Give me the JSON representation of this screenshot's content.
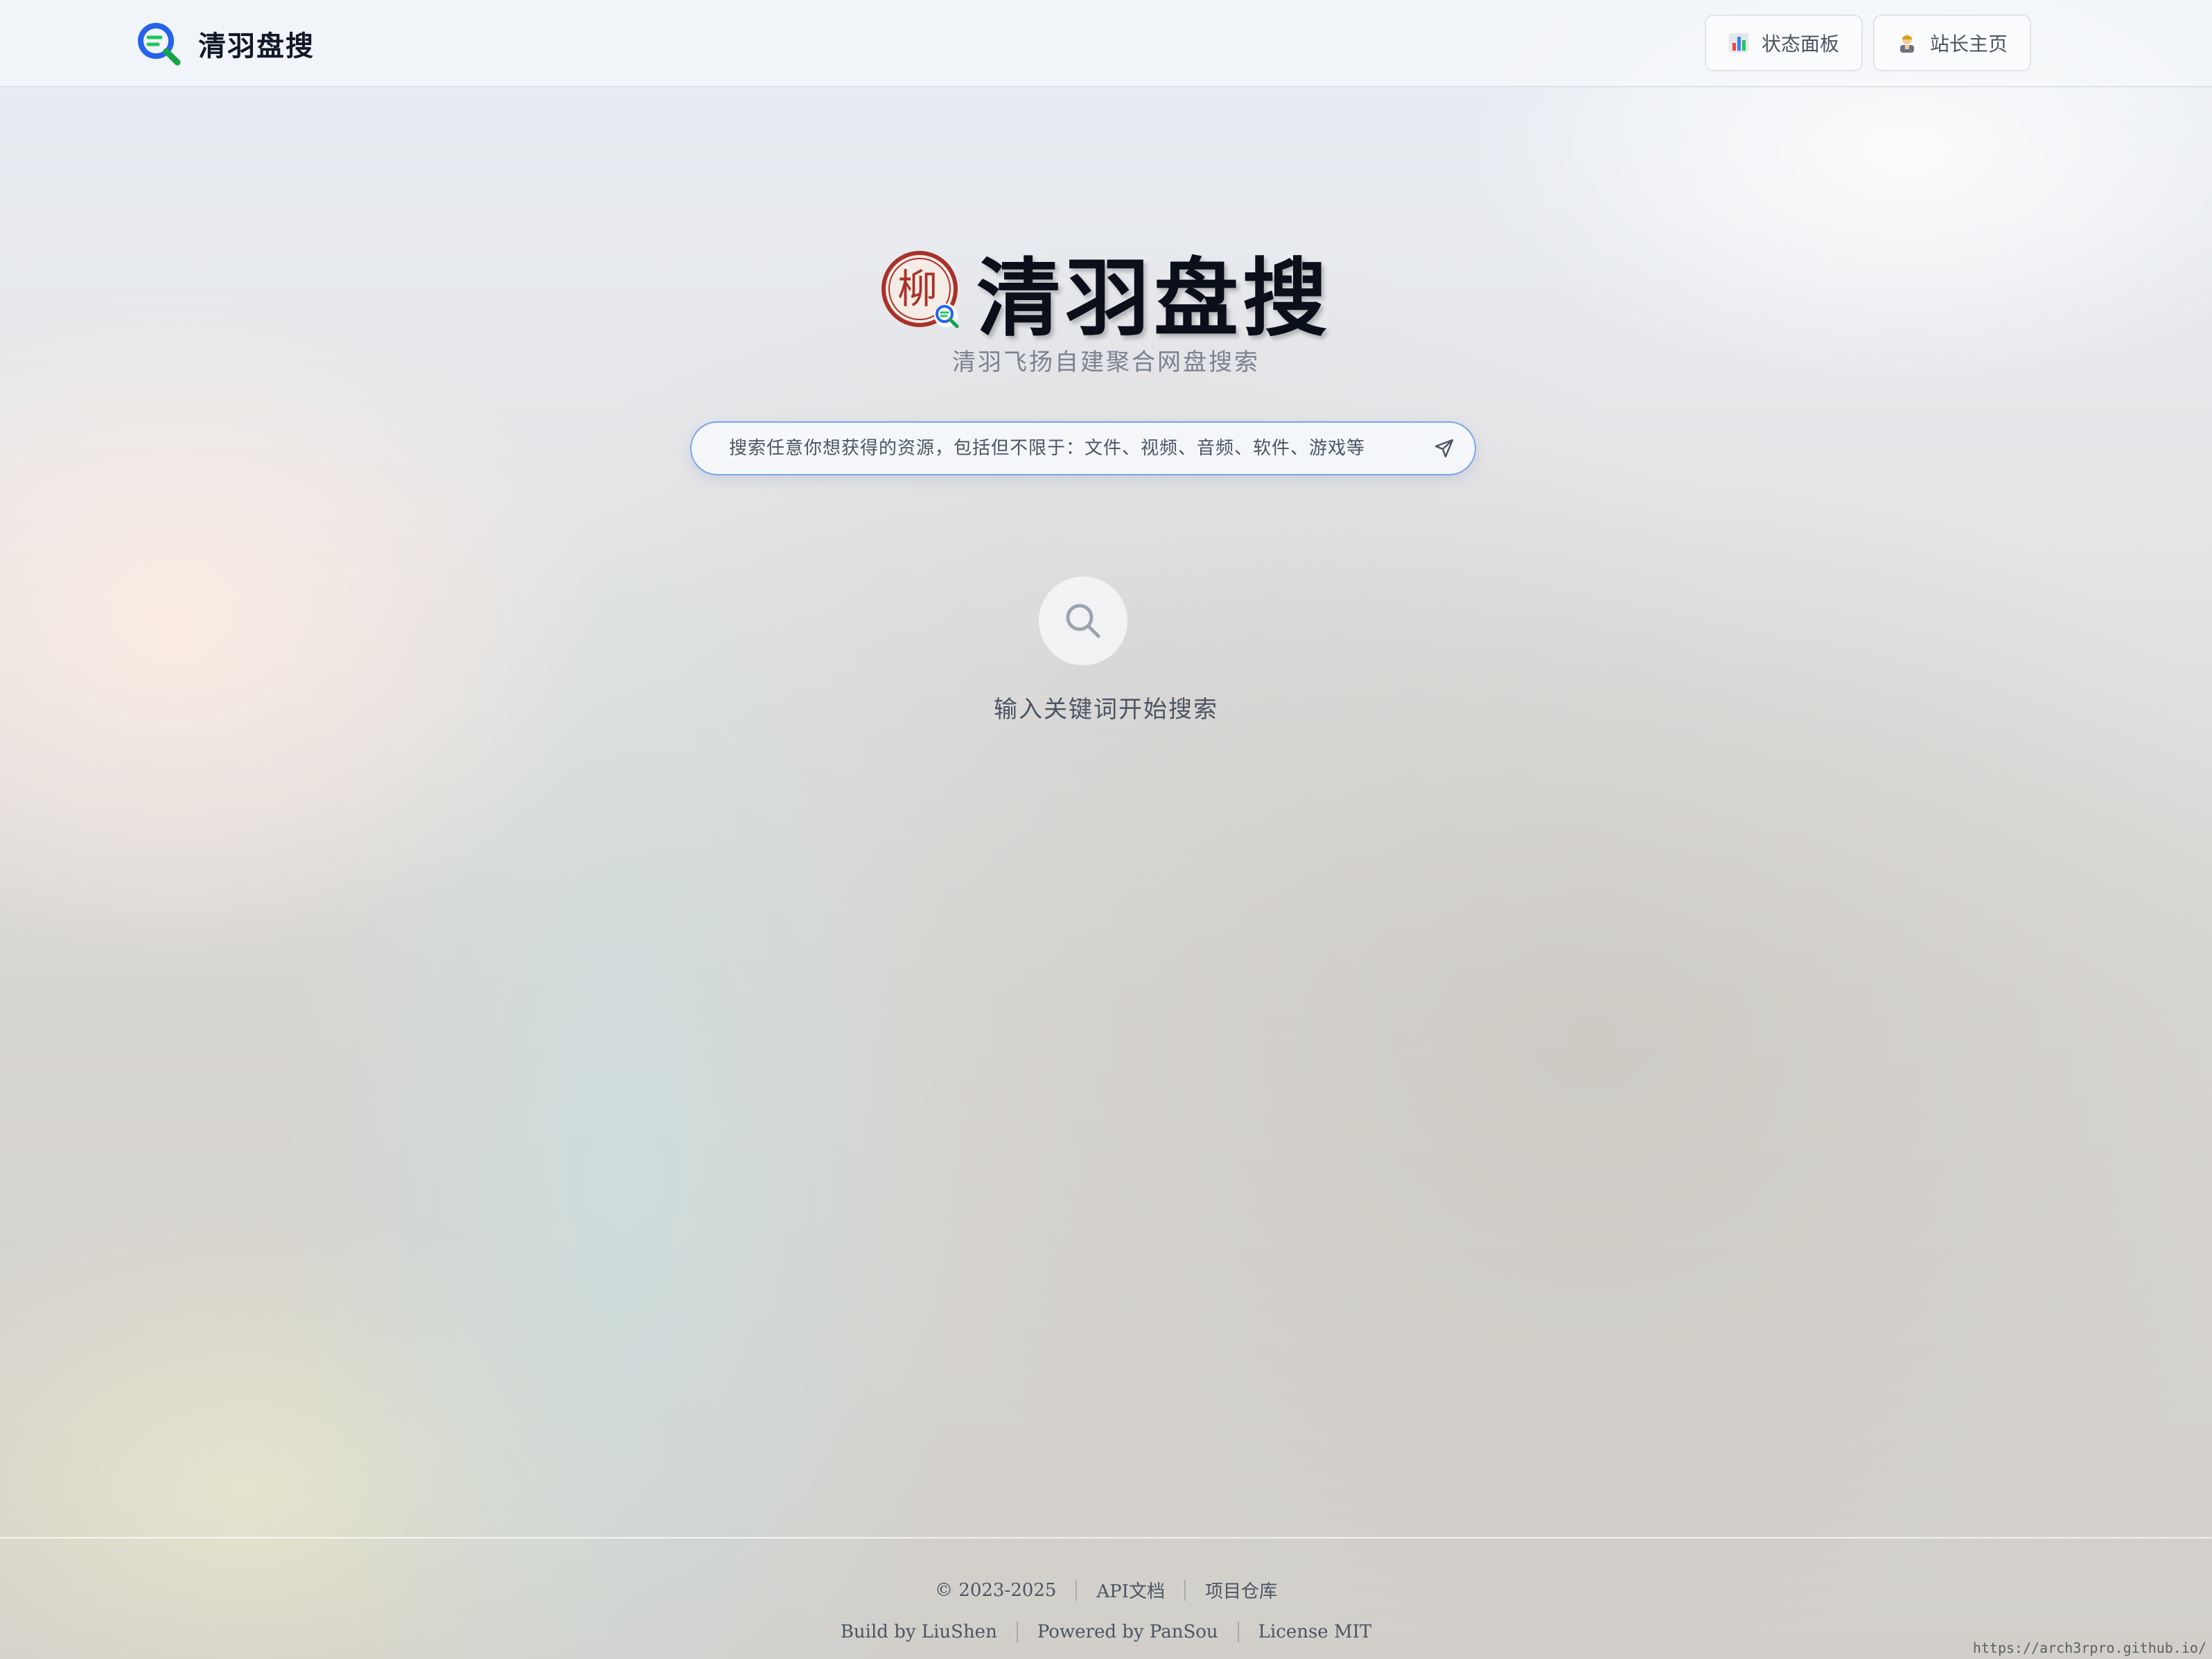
{
  "header": {
    "brand_name": "清羽盘搜",
    "logo_icon": "search-logo-icon",
    "buttons": [
      {
        "label": "状态面板",
        "icon": "bar-chart-icon"
      },
      {
        "label": "站长主页",
        "icon": "person-icon"
      }
    ]
  },
  "hero": {
    "title": "清羽盘搜",
    "seal_text": "柳",
    "subtitle": "清羽飞扬自建聚合网盘搜索"
  },
  "search": {
    "placeholder": "搜索任意你想获得的资源，包括但不限于：文件、视频、音频、软件、游戏等",
    "value": "",
    "submit_icon": "send-icon"
  },
  "empty_state": {
    "icon": "search-icon",
    "text": "输入关键词开始搜索"
  },
  "footer": {
    "copyright": "© 2023-2025",
    "api_docs": "API文档",
    "repo": "项目仓库",
    "build_by": "Build by LiuShen",
    "powered_by": "Powered by PanSou",
    "license": "License MIT"
  },
  "watermark": "https://arch3rpro.github.io/",
  "colors": {
    "accent_blue": "#2563eb",
    "accent_green": "#22c55e",
    "search_border": "#7aa4ee",
    "seal_red": "#a8322a"
  }
}
